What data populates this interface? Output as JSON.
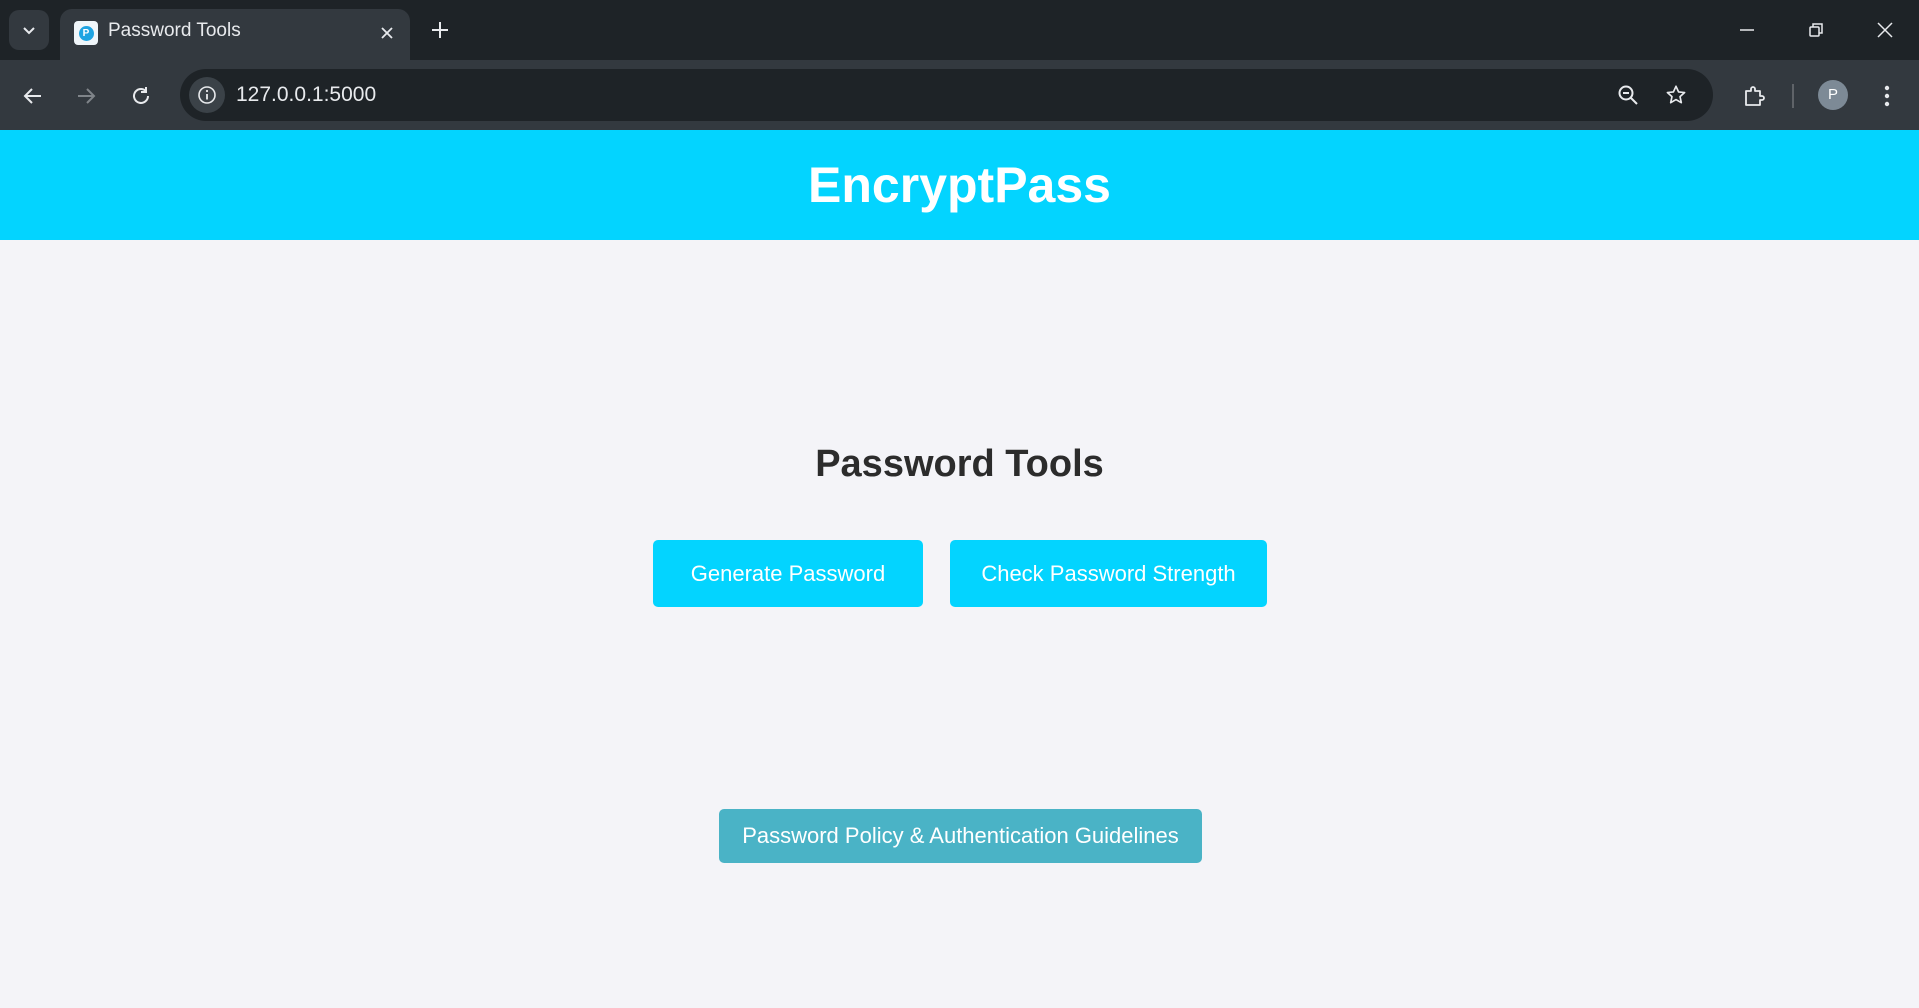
{
  "browser": {
    "tab": {
      "title": "Password Tools",
      "favicon_letter": "P"
    },
    "address_bar": {
      "url": "127.0.0.1:5000"
    },
    "profile": {
      "initial": "P"
    }
  },
  "header": {
    "title": "EncryptPass"
  },
  "main": {
    "heading": "Password Tools",
    "buttons": {
      "generate": "Generate Password",
      "check_strength": "Check Password Strength",
      "policy": "Password Policy & Authentication Guidelines"
    }
  },
  "colors": {
    "accent": "#03d4ff",
    "policy_button": "#4ab3c6",
    "page_background": "#f4f4f8",
    "heading_text": "#2c2c2c"
  },
  "icons": {
    "tab_search": "chevron-down-icon",
    "tab_close": "close-icon",
    "new_tab": "plus-icon",
    "back": "arrow-left-icon",
    "forward": "arrow-right-icon",
    "reload": "reload-icon",
    "site_info": "info-icon",
    "zoom": "zoom-out-icon",
    "bookmark": "star-icon",
    "extensions": "puzzle-icon",
    "menu": "more-vertical-icon",
    "minimize": "minimize-icon",
    "restore": "restore-icon",
    "close_window": "close-icon"
  }
}
